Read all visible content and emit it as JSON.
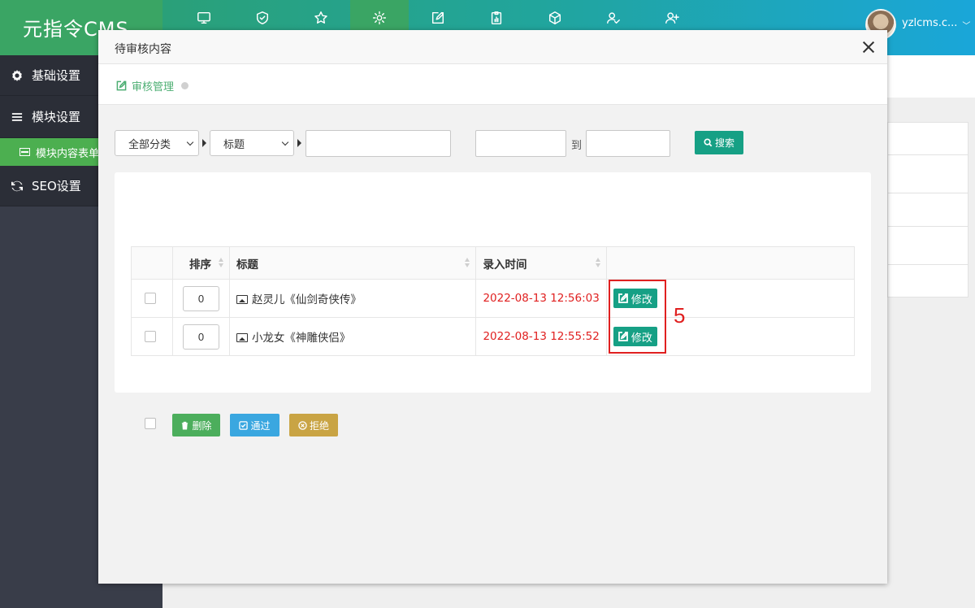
{
  "app": {
    "logo_text": "元指令CMS"
  },
  "topnav": {
    "items": [
      {
        "icon": "monitor-icon"
      },
      {
        "icon": "shield-check-icon"
      },
      {
        "icon": "star-icon"
      },
      {
        "icon": "gear-icon",
        "active": true
      },
      {
        "icon": "edit-icon"
      },
      {
        "icon": "clipboard-chart-icon"
      },
      {
        "icon": "cube-icon"
      },
      {
        "icon": "user-check-icon"
      },
      {
        "icon": "user-add-icon"
      }
    ]
  },
  "user": {
    "name": "yzlcms.c...",
    "caret": "﹀"
  },
  "sidebar": {
    "items": [
      {
        "label": "基础设置",
        "icon": "gear-icon"
      },
      {
        "label": "模块设置",
        "icon": "menu-icon"
      },
      {
        "label": "SEO设置",
        "icon": "refresh-icon"
      }
    ],
    "sub_item": {
      "label": "模块内容表单"
    }
  },
  "modal": {
    "title": "待审核内容",
    "breadcrumb": "审核管理"
  },
  "filters": {
    "category_select": "全部分类",
    "field_select": "标题",
    "keyword_value": "",
    "date_from_value": "",
    "date_separator": "到",
    "date_to_value": "",
    "search_label": "搜索"
  },
  "table": {
    "headers": {
      "order": "排序",
      "title": "标题",
      "time": "录入时间"
    },
    "rows": [
      {
        "order": "0",
        "title": "赵灵儿《仙剑奇侠传》",
        "time": "2022-08-13 12:56:03",
        "action": "修改"
      },
      {
        "order": "0",
        "title": "小龙女《神雕侠侣》",
        "time": "2022-08-13 12:55:52",
        "action": "修改"
      }
    ]
  },
  "annotation": {
    "number": "5",
    "color": "#e02020"
  },
  "footer": {
    "delete_label": "删除",
    "pass_label": "通过",
    "reject_label": "拒绝"
  },
  "colors": {
    "accent": "#16a085",
    "brand_green": "#3aa564",
    "danger_text": "#e02020",
    "info": "#3aa7e0",
    "warning": "#c9a444"
  }
}
